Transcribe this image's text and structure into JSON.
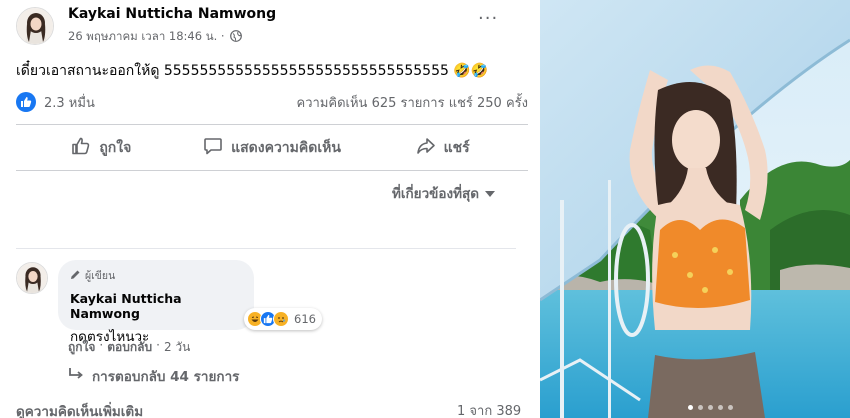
{
  "post": {
    "author": "Kaykai Nutticha Namwong",
    "timestamp": "26 พฤษภาคม เวลา 18:46 น. ·",
    "privacy_icon": "globe-icon",
    "text": "เดี๋ยวเอาสถานะออกให้ดู 55555555555555555555555555555555 🤣🤣",
    "reaction_count": "2.3 หมื่น",
    "stats": "ความคิดเห็น 625 รายการ  แชร์ 250 ครั้ง",
    "more_label": "···"
  },
  "actions": {
    "like": "ถูกใจ",
    "comment": "แสดงความคิดเห็น",
    "share": "แชร์"
  },
  "sort": {
    "label": "ที่เกี่ยวข้องที่สุด"
  },
  "comment": {
    "badge": "ผู้เขียน",
    "author": "Kaykai Nutticha Namwong",
    "text": "กดตรงไหนวะ",
    "reaction_count": "616",
    "like_label": "ถูกใจ",
    "separator": "·",
    "reply_label": "ตอบกลับ",
    "age": "2 วัน",
    "replies_label": "การตอบกลับ 44 รายการ"
  },
  "footer": {
    "view_more": "ดูความคิดเห็นเพิ่มเติม",
    "pager": "1 จาก 389"
  },
  "colors": {
    "facebook_blue": "#1877f2",
    "secondary_text": "#65676b",
    "bubble_bg": "#f0f2f5"
  }
}
